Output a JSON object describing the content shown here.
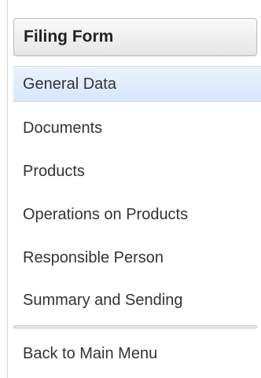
{
  "sidebar": {
    "title": "Filing Form",
    "items": [
      {
        "label": "General Data"
      },
      {
        "label": "Documents"
      },
      {
        "label": "Products"
      },
      {
        "label": "Operations on Products"
      },
      {
        "label": "Responsible Person"
      },
      {
        "label": "Summary and Sending"
      }
    ],
    "back_label": "Back to Main Menu",
    "active_color": "#d7e6fb"
  }
}
